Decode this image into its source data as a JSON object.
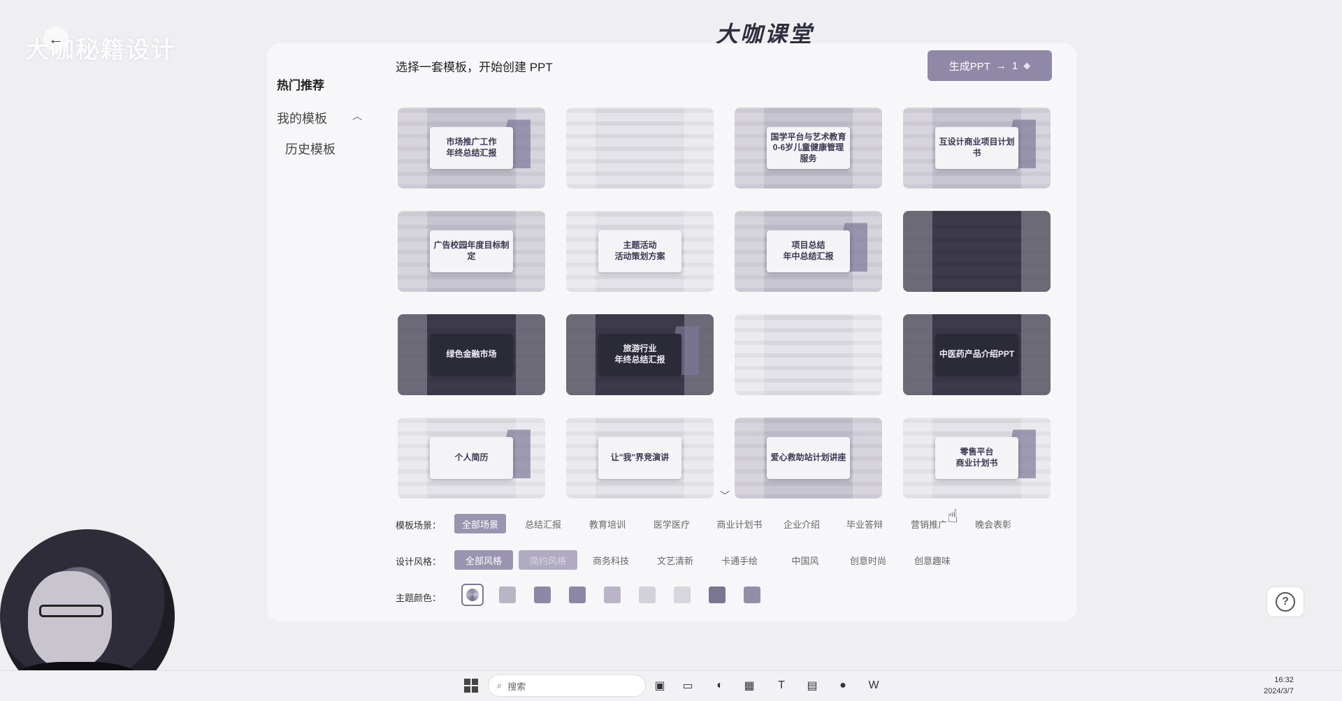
{
  "watermark": "大咖秘籍设计",
  "brand": {
    "name": "大咖课堂"
  },
  "sidebar": {
    "title": "热门推荐",
    "my_templates": "我的模板",
    "history": "历史模板"
  },
  "heading": "选择一套模板，开始创建 PPT",
  "generate_button": {
    "label": "生成PPT",
    "arrow": "→",
    "count": "1",
    "gem": "◆"
  },
  "templates": [
    {
      "title": "市场推广工作\n年终总结汇报",
      "style": "mid"
    },
    {
      "title": "",
      "style": "light"
    },
    {
      "title": "国学平台与艺术教育\n0-6岁儿童健康管理服务",
      "style": "mid"
    },
    {
      "title": "互设计商业项目计划书",
      "style": "mid"
    },
    {
      "title": "广告校园年度目标制定",
      "style": "mid"
    },
    {
      "title": "主题活动\n活动策划方案",
      "style": "light"
    },
    {
      "title": "项目总结\n年中总结汇报",
      "style": "mid"
    },
    {
      "title": "",
      "style": "dark"
    },
    {
      "title": "绿色金融市场",
      "style": "dark"
    },
    {
      "title": "旅游行业\n年终总结汇报",
      "style": "dark"
    },
    {
      "title": "",
      "style": "light"
    },
    {
      "title": "中医药产品介绍PPT",
      "style": "dark"
    },
    {
      "title": "个人简历",
      "style": "light"
    },
    {
      "title": "让\"我\"界竞演讲",
      "style": "light"
    },
    {
      "title": "爱心救助站计划讲座",
      "style": "mid"
    },
    {
      "title": "零售平台\n商业计划书",
      "style": "light"
    }
  ],
  "filters": {
    "scene_label": "模板场景：",
    "scenes": [
      "全部场景",
      "总结汇报",
      "教育培训",
      "医学医疗",
      "商业计划书",
      "企业介绍",
      "毕业答辩",
      "营销推广",
      "晚会表彰"
    ],
    "style_label": "设计风格：",
    "styles": [
      "全部风格",
      "简约风格",
      "商务科技",
      "文艺清新",
      "卡通手绘",
      "中国风",
      "创意时尚",
      "创意趣味"
    ],
    "color_label": "主题颜色："
  },
  "colors": [
    "#b8b5c4",
    "#8e88a6",
    "#8d87a5",
    "#b9b5c6",
    "#d3d1da",
    "#d7d5de",
    "#7b7690",
    "#948fa9"
  ],
  "help_icon": "?",
  "taskbar": {
    "search_placeholder": "搜索",
    "time": "16:32",
    "date": "2024/3/7"
  }
}
